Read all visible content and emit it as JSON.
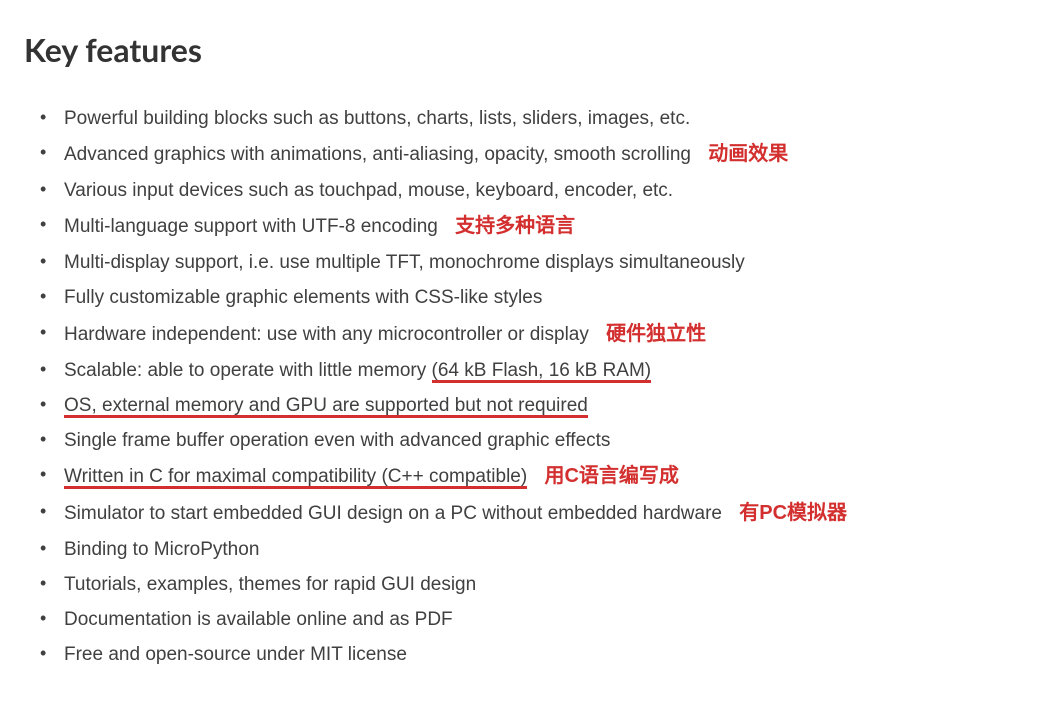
{
  "title": "Key features",
  "features": [
    {
      "text": "Powerful building blocks such as buttons, charts, lists, sliders, images, etc."
    },
    {
      "text": "Advanced graphics with animations, anti-aliasing, opacity, smooth scrolling",
      "annotation": "动画效果"
    },
    {
      "text": "Various input devices such as touchpad, mouse, keyboard, encoder, etc."
    },
    {
      "text": "Multi-language support with UTF-8 encoding",
      "annotation": "支持多种语言"
    },
    {
      "text": "Multi-display support, i.e. use multiple TFT, monochrome displays simultaneously"
    },
    {
      "text": "Fully customizable graphic elements with CSS-like styles"
    },
    {
      "text": "Hardware independent: use with any microcontroller or display",
      "annotation": "硬件独立性"
    },
    {
      "text_prefix": "Scalable: able to operate with little memory ",
      "underlined": "(64 kB Flash, 16 kB RAM)"
    },
    {
      "underlined": "OS, external memory and GPU are supported but not required"
    },
    {
      "text": "Single frame buffer operation even with advanced graphic effects"
    },
    {
      "underlined": "Written in C for maximal compatibility (C++ compatible)",
      "annotation": "用C语言编写成"
    },
    {
      "text": "Simulator to start embedded GUI design on a PC without embedded hardware",
      "annotation": "有PC模拟器"
    },
    {
      "text": "Binding to MicroPython"
    },
    {
      "text": "Tutorials, examples, themes for rapid GUI design"
    },
    {
      "text": "Documentation is available online and as PDF"
    },
    {
      "text": "Free and open-source under MIT license"
    }
  ],
  "colors": {
    "annotation_red": "#d32f2f",
    "text_gray": "#404040",
    "heading_gray": "#333333"
  }
}
